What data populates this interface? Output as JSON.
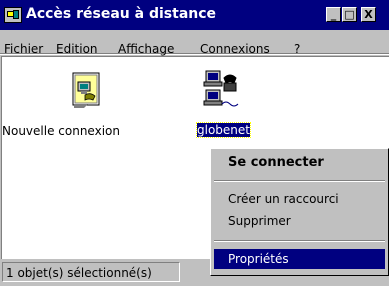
{
  "window": {
    "title": "Accès réseau à distance",
    "minimize_label": "_",
    "maximize_label": "□",
    "close_label": "X"
  },
  "menu": {
    "items": [
      {
        "label": "Fichier"
      },
      {
        "label": "Edition"
      },
      {
        "label": "Affichage"
      },
      {
        "label": "Connexions"
      },
      {
        "label": "?"
      }
    ]
  },
  "icons": [
    {
      "label": "Nouvelle connexion",
      "icon": "new-connection-icon",
      "selected": false
    },
    {
      "label": "globenet",
      "icon": "network-computer-icon",
      "selected": true
    }
  ],
  "context_menu": {
    "items": [
      {
        "label": "Se connecter",
        "bold": true
      },
      {
        "label": "Créer un raccourci"
      },
      {
        "label": "Supprimer"
      },
      {
        "label": "Propriétés",
        "highlighted": true
      }
    ]
  },
  "status": {
    "text": "1 objet(s) sélectionné(s)"
  },
  "colors": {
    "titlebar": "#000080",
    "face": "#c0c0c0",
    "highlight": "#000080"
  }
}
